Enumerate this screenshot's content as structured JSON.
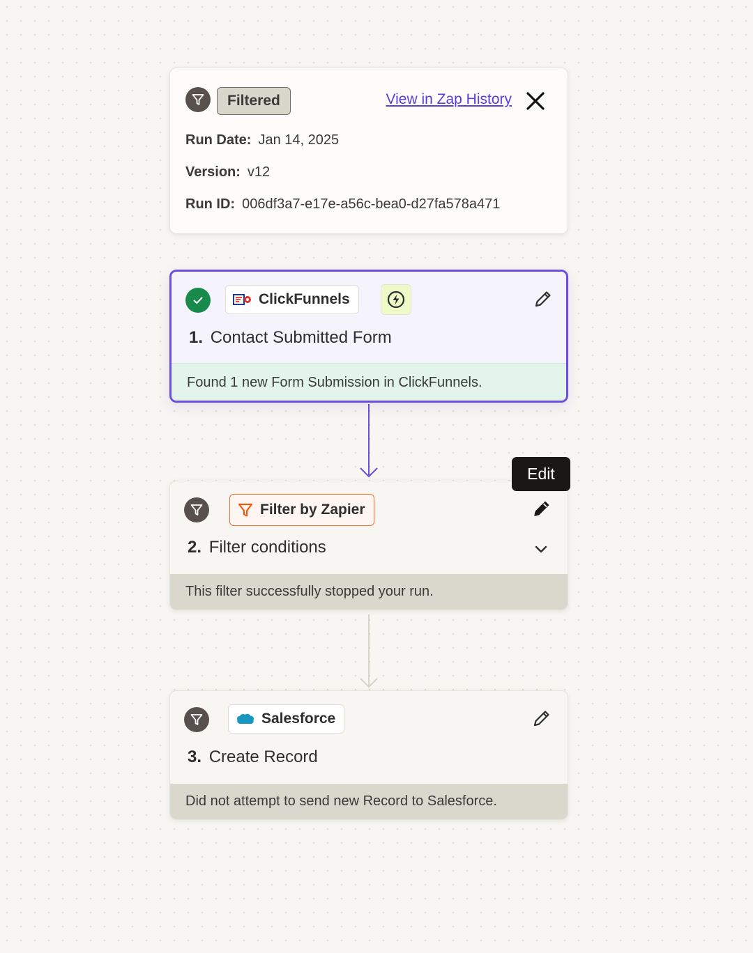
{
  "run": {
    "status": "Filtered",
    "history_link": "View in Zap History",
    "run_date_label": "Run Date:",
    "run_date": "Jan 14, 2025",
    "version_label": "Version:",
    "version": "v12",
    "run_id_label": "Run ID:",
    "run_id": "006df3a7-e17e-a56c-bea0-d27fa578a471"
  },
  "steps": [
    {
      "number": "1.",
      "app": "ClickFunnels",
      "title": "Contact Submitted Form",
      "footer": "Found 1 new Form Submission in ClickFunnels.",
      "status": "success"
    },
    {
      "number": "2.",
      "app": "Filter by Zapier",
      "title": "Filter conditions",
      "footer": "This filter successfully stopped your run.",
      "status": "filtered"
    },
    {
      "number": "3.",
      "app": "Salesforce",
      "title": "Create Record",
      "footer": "Did not attempt to send new Record to Salesforce.",
      "status": "filtered"
    }
  ],
  "tooltip": {
    "label": "Edit"
  },
  "colors": {
    "accent": "#6b4ee0",
    "success": "#188a4b",
    "filter_orange": "#ff4f00",
    "link": "#5a3fd6"
  },
  "icons": {
    "status": "filter-icon",
    "close": "close-icon",
    "edit": "pencil-icon",
    "trigger": "lightning-bolt-icon",
    "expand": "chevron-down-icon"
  }
}
